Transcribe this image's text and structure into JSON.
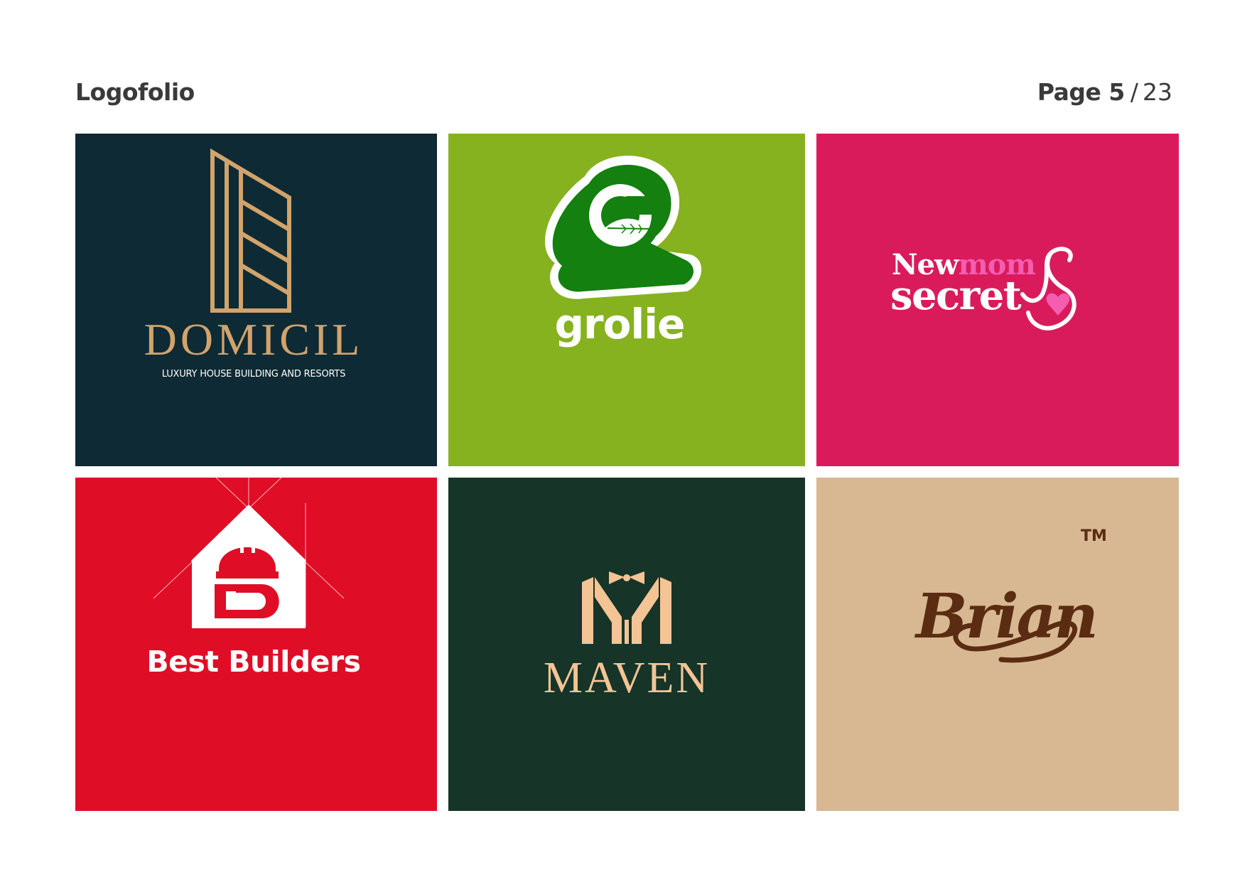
{
  "header": {
    "title": "Logofolio",
    "page_label": "Page 5",
    "page_separator": "/",
    "page_total": "23"
  },
  "logos": [
    {
      "name": "DOMICIL",
      "tagline": "LUXURY HOUSE BUILDING AND RESORTS",
      "background": "#0e2a34",
      "accent": "#d2a36b",
      "icon": "building-lines-icon"
    },
    {
      "name": "grolie",
      "background": "#86b21f",
      "accent": "#13800f",
      "icon": "leaf-g-icon"
    },
    {
      "name_part1": "New",
      "name_part2": "mom",
      "name_part3": "secret",
      "background": "#d91b5c",
      "accent": "#f45db0",
      "icon": "heart-swirl-icon"
    },
    {
      "name": "Best Builders",
      "background": "#e00d26",
      "accent": "#ffffff",
      "icon": "house-helmet-b-icon"
    },
    {
      "name": "MAVEN",
      "background": "#163428",
      "accent": "#f4c495",
      "icon": "m-bowtie-icon"
    },
    {
      "name": "Brian",
      "trademark": "TM",
      "background": "#d8b893",
      "accent": "#5a2c12",
      "icon": "script-signature-icon"
    }
  ]
}
